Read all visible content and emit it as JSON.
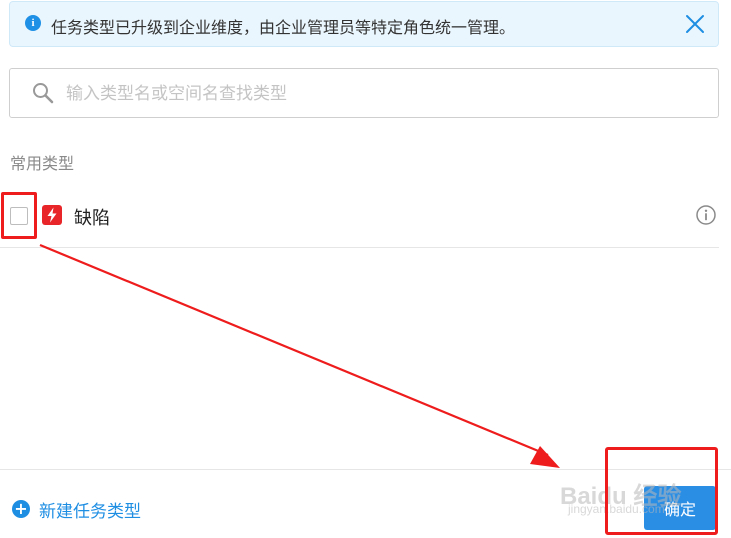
{
  "notice": {
    "icon": "info-icon",
    "text": "任务类型已升级到企业维度，由企业管理员等特定角色统一管理。",
    "close_icon": "close-icon"
  },
  "search": {
    "icon": "search-icon",
    "value": "",
    "placeholder": "输入类型名或空间名查找类型"
  },
  "section": {
    "title": "常用类型"
  },
  "types": [
    {
      "label": "缺陷",
      "checked": false,
      "icon": "lightning-bolt-icon",
      "icon_color": "#e8262a",
      "info_icon": "info-circle-icon"
    }
  ],
  "footer": {
    "new_type_label": "新建任务类型",
    "confirm_label": "确定"
  },
  "annotations": {
    "highlight_color": "#ee1c1c",
    "arrow_color": "#ee1c1c"
  },
  "watermark": {
    "main": "Baidu 经验",
    "sub": "jingyan.baidu.com"
  },
  "colors": {
    "accent": "#1e8ee3",
    "button": "#2b8ee5",
    "notice_bg": "#eaf6fd"
  }
}
